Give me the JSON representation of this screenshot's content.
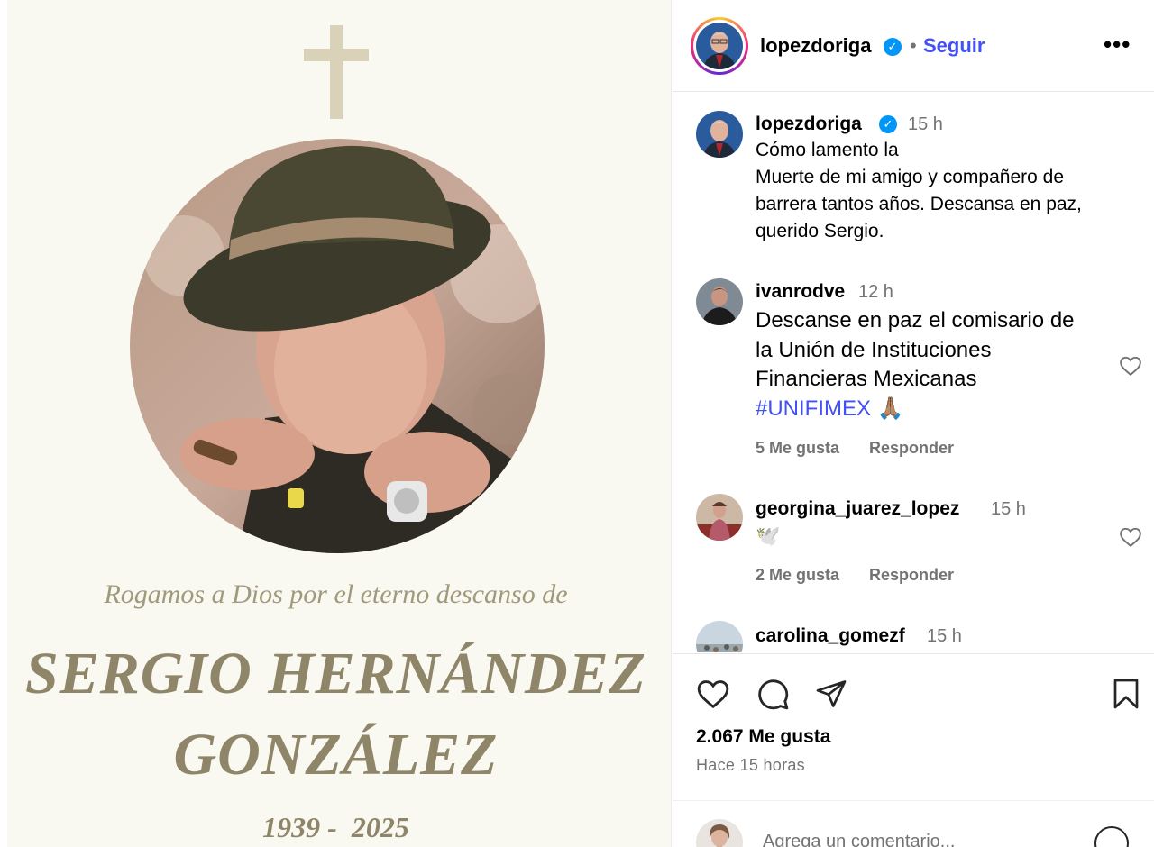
{
  "post_image": {
    "prayer_line": "Rogamos a Dios por el eterno descanso de",
    "name_line1": "SERGIO HERNÁNDEZ",
    "name_line2": "GONZÁLEZ",
    "years": "1939 -  2025",
    "icons": [
      "cross-icon"
    ]
  },
  "header": {
    "username": "lopezdoriga",
    "verified_icon": "verified-badge-icon",
    "separator": "•",
    "follow_label": "Seguir",
    "more_label": "•••"
  },
  "caption": {
    "username": "lopezdoriga",
    "time": "15 h",
    "lines": [
      "Cómo lamento la",
      "Muerte de mi amigo y compañero de",
      "barrera tantos años. Descansa en paz,",
      "querido Sergio."
    ]
  },
  "comments": [
    {
      "username": "ivanrodve",
      "time": "12 h",
      "lines": [
        "Descanse en paz el comisario de",
        "la Unión de Instituciones",
        "Financieras Mexicanas"
      ],
      "hashtag": "#UNIFIMEX",
      "emoji": "🙏🏽",
      "likes_label": "5 Me gusta",
      "reply_label": "Responder"
    },
    {
      "username": "georgina_juarez_lopez",
      "time": "15 h",
      "emoji": "🕊️",
      "likes_label": "2 Me gusta",
      "reply_label": "Responder"
    },
    {
      "username": "carolina_gomezf",
      "time": "15 h"
    }
  ],
  "actions": {
    "icons": [
      "heart-icon",
      "comment-icon",
      "share-icon",
      "bookmark-icon"
    ],
    "likes": "2.067 Me gusta",
    "time_ago": "Hace 15 horas"
  },
  "composer": {
    "placeholder": "Agrega un comentario...",
    "icon": "emoji-icon"
  },
  "colors": {
    "link_blue": "#4150f7",
    "verified_blue": "#0095f6",
    "muted_gray": "#737373",
    "card_bg": "#f9f8f1",
    "gold_text": "#8f8568"
  }
}
